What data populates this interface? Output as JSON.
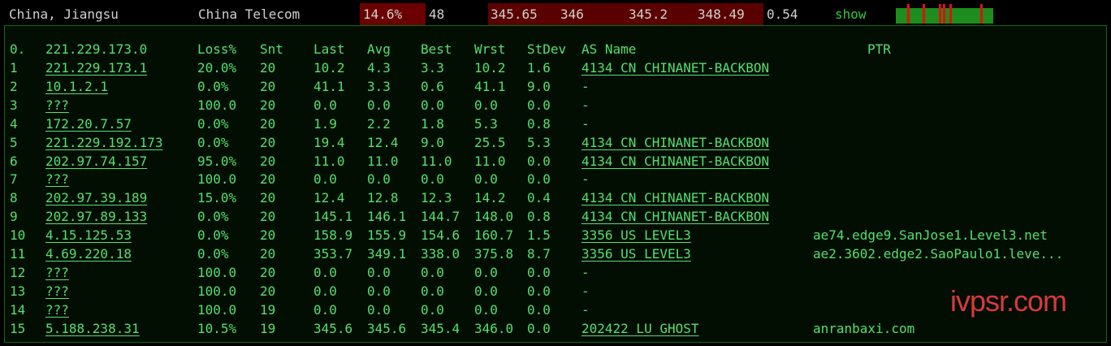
{
  "summary": {
    "location": "China, Jiangsu",
    "isp": "China Telecom",
    "loss": "14.6%",
    "sent": "48",
    "last": "345.65",
    "avg": "346",
    "best": "345.2",
    "worst": "348.49",
    "stdev": "0.54",
    "show_label": "show",
    "sparkline": {
      "bar_color": "#e01010",
      "base_color": "#1e8c1e"
    }
  },
  "table": {
    "headers": {
      "host": "221.229.173.0",
      "hop0": "0.",
      "loss": "Loss%",
      "snt": "Snt",
      "last": "Last",
      "avg": "Avg",
      "best": "Best",
      "wrst": "Wrst",
      "stdev": "StDev",
      "as": "AS Name",
      "ptr": "PTR"
    },
    "rows": [
      {
        "hop": "1",
        "host": "221.229.173.1",
        "loss": "20.0%",
        "snt": "20",
        "last": "10.2",
        "avg": "4.3",
        "best": "3.3",
        "wrst": "10.2",
        "stdev": "1.6",
        "as": "4134  CN CHINANET-BACKBON",
        "ptr": ""
      },
      {
        "hop": "2",
        "host": "10.1.2.1",
        "loss": "0.0%",
        "snt": "20",
        "last": "41.1",
        "avg": "3.3",
        "best": "0.6",
        "wrst": "41.1",
        "stdev": "9.0",
        "as": "-",
        "ptr": ""
      },
      {
        "hop": "3",
        "host": "???",
        "loss": "100.0",
        "snt": "20",
        "last": "0.0",
        "avg": "0.0",
        "best": "0.0",
        "wrst": "0.0",
        "stdev": "0.0",
        "as": "-",
        "ptr": ""
      },
      {
        "hop": "4",
        "host": "172.20.7.57",
        "loss": "0.0%",
        "snt": "20",
        "last": "1.9",
        "avg": "2.2",
        "best": "1.8",
        "wrst": "5.3",
        "stdev": "0.8",
        "as": "-",
        "ptr": ""
      },
      {
        "hop": "5",
        "host": "221.229.192.173",
        "loss": "0.0%",
        "snt": "20",
        "last": "19.4",
        "avg": "12.4",
        "best": "9.0",
        "wrst": "25.5",
        "stdev": "5.3",
        "as": "4134  CN CHINANET-BACKBON",
        "ptr": ""
      },
      {
        "hop": "6",
        "host": "202.97.74.157",
        "loss": "95.0%",
        "snt": "20",
        "last": "11.0",
        "avg": "11.0",
        "best": "11.0",
        "wrst": "11.0",
        "stdev": "0.0",
        "as": "4134  CN CHINANET-BACKBON",
        "ptr": ""
      },
      {
        "hop": "7",
        "host": "???",
        "loss": "100.0",
        "snt": "20",
        "last": "0.0",
        "avg": "0.0",
        "best": "0.0",
        "wrst": "0.0",
        "stdev": "0.0",
        "as": "-",
        "ptr": ""
      },
      {
        "hop": "8",
        "host": "202.97.39.189",
        "loss": "15.0%",
        "snt": "20",
        "last": "12.4",
        "avg": "12.8",
        "best": "12.3",
        "wrst": "14.2",
        "stdev": "0.4",
        "as": "4134  CN CHINANET-BACKBON",
        "ptr": ""
      },
      {
        "hop": "9",
        "host": "202.97.89.133",
        "loss": "0.0%",
        "snt": "20",
        "last": "145.1",
        "avg": "146.1",
        "best": "144.7",
        "wrst": "148.0",
        "stdev": "0.8",
        "as": "4134  CN CHINANET-BACKBON",
        "ptr": ""
      },
      {
        "hop": "10",
        "host": "4.15.125.53",
        "loss": "0.0%",
        "snt": "20",
        "last": "158.9",
        "avg": "155.9",
        "best": "154.6",
        "wrst": "160.7",
        "stdev": "1.5",
        "as": "3356  US LEVEL3",
        "ptr": "ae74.edge9.SanJose1.Level3.net"
      },
      {
        "hop": "11",
        "host": "4.69.220.18",
        "loss": "0.0%",
        "snt": "20",
        "last": "353.7",
        "avg": "349.1",
        "best": "338.0",
        "wrst": "375.8",
        "stdev": "8.7",
        "as": "3356  US LEVEL3",
        "ptr": "ae2.3602.edge2.SaoPaulo1.leve..."
      },
      {
        "hop": "12",
        "host": "???",
        "loss": "100.0",
        "snt": "20",
        "last": "0.0",
        "avg": "0.0",
        "best": "0.0",
        "wrst": "0.0",
        "stdev": "0.0",
        "as": "-",
        "ptr": ""
      },
      {
        "hop": "13",
        "host": "???",
        "loss": "100.0",
        "snt": "20",
        "last": "0.0",
        "avg": "0.0",
        "best": "0.0",
        "wrst": "0.0",
        "stdev": "0.0",
        "as": "-",
        "ptr": ""
      },
      {
        "hop": "14",
        "host": "???",
        "loss": "100.0",
        "snt": "19",
        "last": "0.0",
        "avg": "0.0",
        "best": "0.0",
        "wrst": "0.0",
        "stdev": "0.0",
        "as": "-",
        "ptr": ""
      },
      {
        "hop": "15",
        "host": "5.188.238.31",
        "loss": "10.5%",
        "snt": "19",
        "last": "345.6",
        "avg": "345.6",
        "best": "345.4",
        "wrst": "346.0",
        "stdev": "0.0",
        "as": "202422 LU GHOST",
        "ptr": "anranbaxi.com"
      }
    ]
  },
  "watermark": "ivpsr.com",
  "colors": {
    "text_green": "#55e06b",
    "loss_bg": "#6b0000",
    "latency_bg": "#5a0000",
    "watermark": "#d73a3a"
  }
}
